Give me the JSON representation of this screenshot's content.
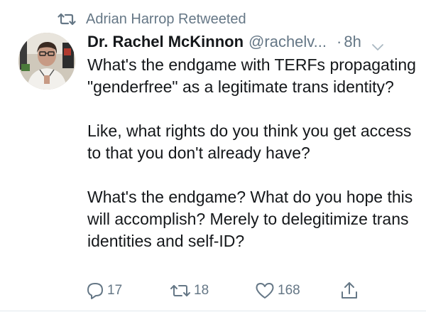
{
  "retweet": {
    "icon": "retweet-icon",
    "text": "Adrian Harrop Retweeted"
  },
  "tweet": {
    "avatar": "avatar",
    "display_name": "Dr. Rachel McKinnon",
    "handle": "@rachelv...",
    "separator": "·",
    "time": "8h",
    "menu_icon": "chevron-down-icon",
    "paragraphs": [
      "What's the endgame with TERFs propagating \"genderfree\" as a legitimate trans identity?",
      "Like, what rights do you think you get access to that you don't already have?",
      "What's the endgame? What do you hope this will accomplish? Merely to delegitimize trans identities and self-ID?"
    ]
  },
  "actions": {
    "reply": {
      "icon": "reply-icon",
      "count": "17"
    },
    "retweet": {
      "icon": "retweet-icon",
      "count": "18"
    },
    "like": {
      "icon": "heart-icon",
      "count": "168"
    },
    "share": {
      "icon": "share-icon"
    }
  },
  "colors": {
    "text": "#14171a",
    "secondary": "#657786",
    "divider": "#e1e8ed"
  }
}
